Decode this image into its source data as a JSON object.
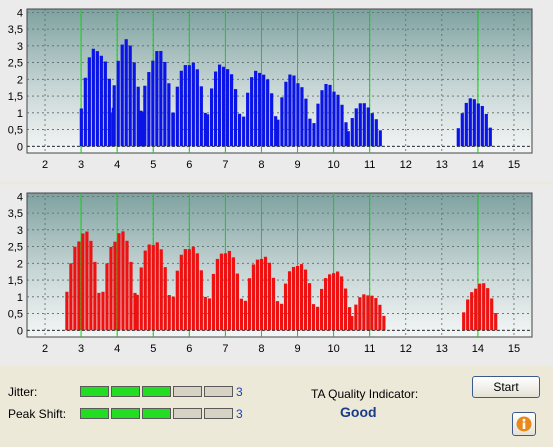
{
  "chart_data": [
    {
      "type": "bar",
      "name": "top-histogram",
      "color": "#0a14e6",
      "xlim": [
        1.5,
        15.5
      ],
      "ylim": [
        -0.2,
        4.1
      ],
      "x_ticks": [
        "2",
        "3",
        "4",
        "5",
        "6",
        "7",
        "8",
        "9",
        "10",
        "11",
        "12",
        "13",
        "14",
        "15"
      ],
      "y_ticks": [
        "0",
        "0,5",
        "1",
        "1,5",
        "2",
        "2,5",
        "3",
        "3,5",
        "4"
      ],
      "grid": true,
      "green_markers": [
        3,
        4,
        5,
        6,
        7,
        8,
        9,
        10,
        11,
        14
      ],
      "peaks": [
        {
          "center": 3.45,
          "height": 3.2
        },
        {
          "center": 4.25,
          "height": 3.2
        },
        {
          "center": 5.1,
          "height": 3.0
        },
        {
          "center": 6.0,
          "height": 2.8
        },
        {
          "center": 6.95,
          "height": 2.7
        },
        {
          "center": 7.95,
          "height": 2.5
        },
        {
          "center": 8.9,
          "height": 2.3
        },
        {
          "center": 9.9,
          "height": 2.0
        },
        {
          "center": 10.85,
          "height": 1.35
        },
        {
          "center": 13.9,
          "height": 1.55
        }
      ]
    },
    {
      "type": "bar",
      "name": "bottom-histogram",
      "color": "#ee1111",
      "xlim": [
        1.5,
        15.5
      ],
      "ylim": [
        -0.2,
        4.1
      ],
      "x_ticks": [
        "2",
        "3",
        "4",
        "5",
        "6",
        "7",
        "8",
        "9",
        "10",
        "11",
        "12",
        "13",
        "14",
        "15"
      ],
      "y_ticks": [
        "0",
        "0,5",
        "1",
        "1,5",
        "2",
        "2,5",
        "3",
        "3,5",
        "4"
      ],
      "grid": true,
      "green_markers": [
        3,
        4,
        5,
        6,
        7,
        8,
        9,
        10,
        11,
        14
      ],
      "peaks": [
        {
          "center": 3.05,
          "height": 3.2
        },
        {
          "center": 4.05,
          "height": 3.2
        },
        {
          "center": 5.0,
          "height": 2.95
        },
        {
          "center": 6.0,
          "height": 2.8
        },
        {
          "center": 7.0,
          "height": 2.65
        },
        {
          "center": 8.0,
          "height": 2.45
        },
        {
          "center": 9.0,
          "height": 2.2
        },
        {
          "center": 10.0,
          "height": 1.95
        },
        {
          "center": 10.95,
          "height": 1.2
        },
        {
          "center": 14.05,
          "height": 1.5
        }
      ]
    }
  ],
  "metrics": {
    "jitter": {
      "label": "Jitter:",
      "value": "3",
      "level": 3,
      "segments": 5
    },
    "peak_shift": {
      "label": "Peak Shift:",
      "value": "3",
      "level": 3,
      "segments": 5
    }
  },
  "quality": {
    "label": "TA Quality Indicator:",
    "value": "Good"
  },
  "buttons": {
    "start": "Start",
    "info_icon": "info-icon"
  },
  "colors": {
    "meter_on": "#22dd22",
    "meter_off": "#d6d3c4",
    "value_text": "#1a3fc8",
    "marker": "#00dd00"
  }
}
